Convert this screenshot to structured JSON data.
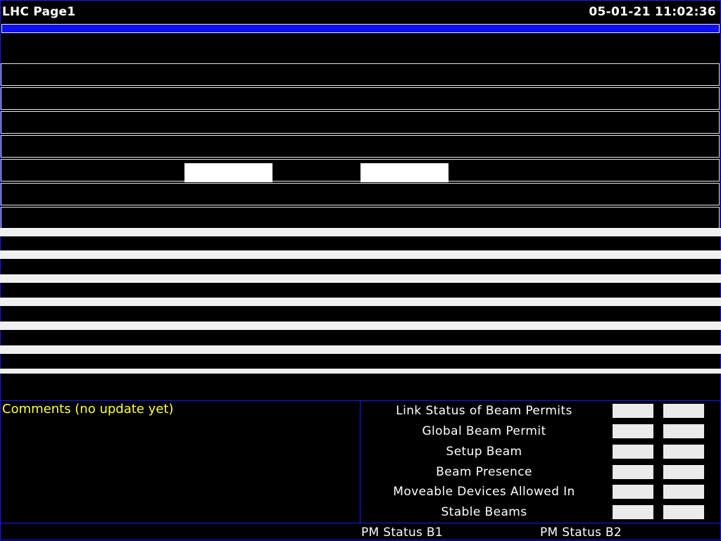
{
  "header": {
    "title": "LHC Page1",
    "datetime": "05-01-21 11:02:36"
  },
  "comments": {
    "title": "Comments (no update yet)"
  },
  "status": {
    "items": [
      {
        "label": "Link Status of Beam Permits"
      },
      {
        "label": "Global Beam Permit"
      },
      {
        "label": "Setup Beam"
      },
      {
        "label": "Beam Presence"
      },
      {
        "label": "Moveable Devices Allowed In"
      },
      {
        "label": "Stable Beams"
      }
    ]
  },
  "footer": {
    "pm_b1": "PM Status B1",
    "pm_b2": "PM Status B2"
  },
  "colors": {
    "frame": "#1a1aff",
    "progress_bar": "#1010ee",
    "comments_text": "#ffff3d",
    "indicator_cell": "#eaeaea"
  }
}
